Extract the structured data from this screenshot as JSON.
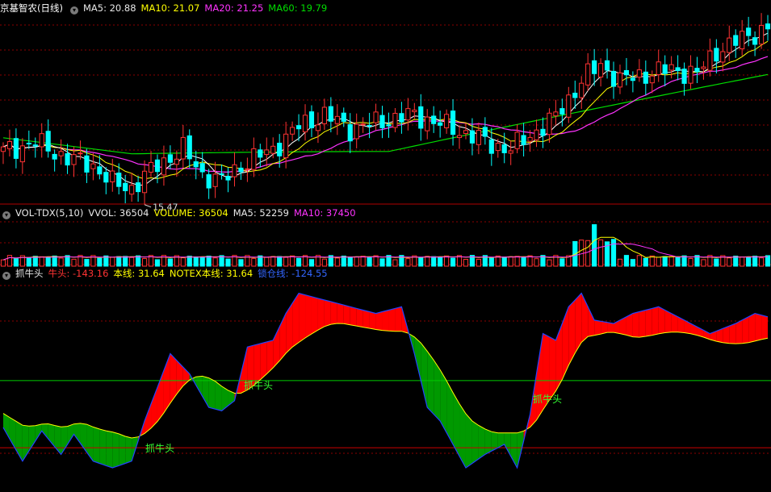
{
  "price_panel": {
    "title": "京基智农(日线)",
    "ma5": "MA5: 20.88",
    "ma10": "MA10: 21.07",
    "ma20": "MA20: 21.25",
    "ma60": "MA60: 19.79",
    "low_label": "15.47"
  },
  "volume_panel": {
    "title": "VOL-TDX(5,10)",
    "vvol": "VVOL: 36504",
    "volume": "VOLUME: 36504",
    "ma5": "MA5: 52259",
    "ma10": "MA10: 37450"
  },
  "indicator_panel": {
    "title": "抓牛头",
    "niutou": "牛头: -143.16",
    "benxian": "本线: 31.64",
    "notex": "NOTEX本线: 31.64",
    "baohu": "锁仓线: -124.55",
    "signal_label": "抓牛头"
  },
  "colors": {
    "up": "#ff3333",
    "down": "#00ffff",
    "ma5": "#ffffff",
    "ma10": "#ffff00",
    "ma20": "#ff33ff",
    "ma60": "#00dd00",
    "grid": "#8b0000",
    "fill_red": "#ff0000",
    "fill_green": "#009900"
  },
  "chart_data": [
    {
      "type": "candlestick",
      "series": [
        "MA5",
        "MA10",
        "MA20",
        "MA60"
      ],
      "low_annotation": 15.47
    },
    {
      "type": "bar",
      "series": [
        "VOLUME",
        "MA5",
        "MA10"
      ]
    },
    {
      "type": "area",
      "series": [
        "牛头",
        "本线"
      ],
      "upper_line": 0,
      "lower_line": -100,
      "signals": [
        "抓牛头",
        "抓牛头",
        "抓牛头"
      ]
    }
  ]
}
